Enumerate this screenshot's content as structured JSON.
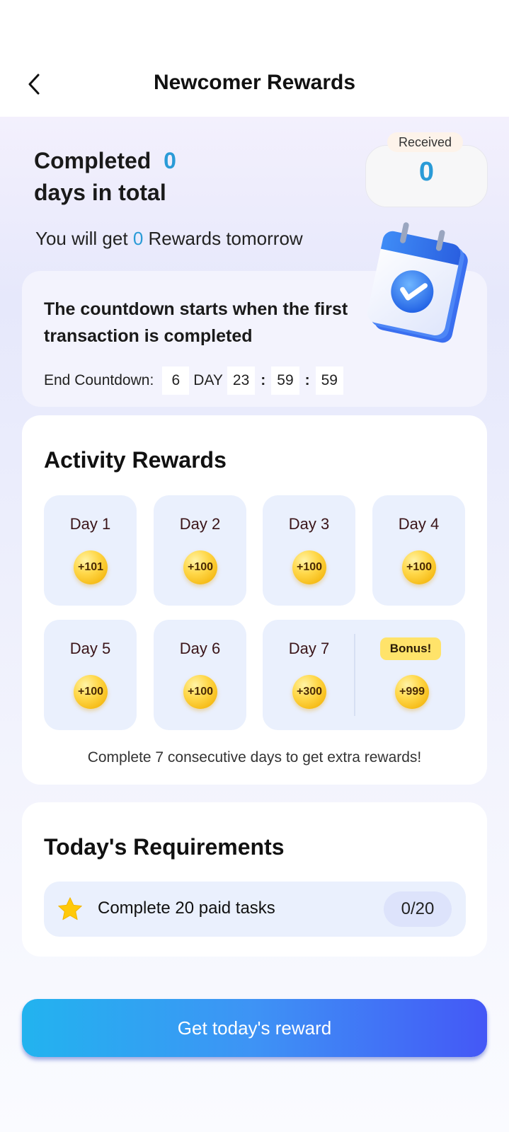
{
  "header": {
    "title": "Newcomer Rewards",
    "back_icon": "chevron-left-icon"
  },
  "summary": {
    "completed_prefix": "Completed",
    "completed_days": "0",
    "completed_suffix": "days in total",
    "received_label": "Received",
    "received_value": "0",
    "tomorrow_prefix": "You will get",
    "tomorrow_value": "0",
    "tomorrow_suffix": "Rewards tomorrow"
  },
  "countdown": {
    "description": "The countdown starts when the first transaction is completed",
    "label": "End Countdown:",
    "days": "6",
    "day_word": "DAY",
    "hours": "23",
    "minutes": "59",
    "seconds": "59",
    "separator": ":"
  },
  "activity": {
    "title": "Activity Rewards",
    "days": [
      {
        "label": "Day 1",
        "reward": "+101"
      },
      {
        "label": "Day 2",
        "reward": "+100"
      },
      {
        "label": "Day 3",
        "reward": "+100"
      },
      {
        "label": "Day 4",
        "reward": "+100"
      },
      {
        "label": "Day 5",
        "reward": "+100"
      },
      {
        "label": "Day 6",
        "reward": "+100"
      },
      {
        "label": "Day 7",
        "reward": "+300"
      }
    ],
    "bonus_label": "Bonus!",
    "bonus_reward": "+999",
    "note": "Complete 7 consecutive days to get extra rewards!"
  },
  "requirements": {
    "title": "Today's Requirements",
    "task_text": "Complete 20 paid tasks",
    "task_progress": "0/20",
    "task_icon": "star-icon"
  },
  "cta": {
    "label": "Get today's reward"
  },
  "colors": {
    "accent": "#2a9bd7",
    "coin": "#ffd84a",
    "cta_start": "#22b3ef",
    "cta_end": "#4458f6"
  }
}
